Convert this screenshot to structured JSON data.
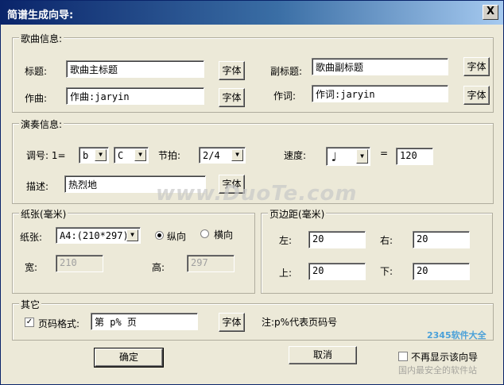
{
  "window": {
    "title": "简谱生成向导:",
    "close_label": "X"
  },
  "song": {
    "legend": "歌曲信息:",
    "title_label": "标题:",
    "title_value": "歌曲主标题",
    "subtitle_label": "副标题:",
    "subtitle_value": "歌曲副标题",
    "composer_label": "作曲:",
    "composer_value": "作曲:jaryin",
    "lyricist_label": "作词:",
    "lyricist_value": "作词:jaryin",
    "font_button": "字体"
  },
  "perf": {
    "legend": "演奏信息:",
    "key_label": "调号: 1=",
    "key_letter": "b",
    "key_note": "C",
    "beat_label": "节拍:",
    "beat_value": "2/4",
    "speed_label": "速度:",
    "speed_note": "♩",
    "equals": "=",
    "speed_value": "120",
    "desc_label": "描述:",
    "desc_value": "热烈地",
    "font_button": "字体"
  },
  "paper": {
    "legend": "纸张(毫米)",
    "size_label": "纸张:",
    "size_value": "A4:(210*297)",
    "portrait_label": "纵向",
    "landscape_label": "横向",
    "orientation": "portrait",
    "width_label": "宽:",
    "width_value": "210",
    "height_label": "高:",
    "height_value": "297"
  },
  "margin": {
    "legend": "页边距(毫米)",
    "left_label": "左:",
    "left_value": "20",
    "right_label": "右:",
    "right_value": "20",
    "top_label": "上:",
    "top_value": "20",
    "bottom_label": "下:",
    "bottom_value": "20"
  },
  "other": {
    "legend": "其它",
    "pagenum_label": "页码格式:",
    "pagenum_checked": true,
    "check_mark": "✓",
    "pagenum_value": "第 p% 页",
    "font_button": "字体",
    "note": "注:p%代表页码号"
  },
  "footer": {
    "ok_label": "确定",
    "cancel_label": "取消",
    "hide_label": "不再显示该向导"
  },
  "watermark": {
    "text": "www.DuoTe.com",
    "brand": "2345软件大全",
    "sub": "国内最安全的软件站"
  }
}
